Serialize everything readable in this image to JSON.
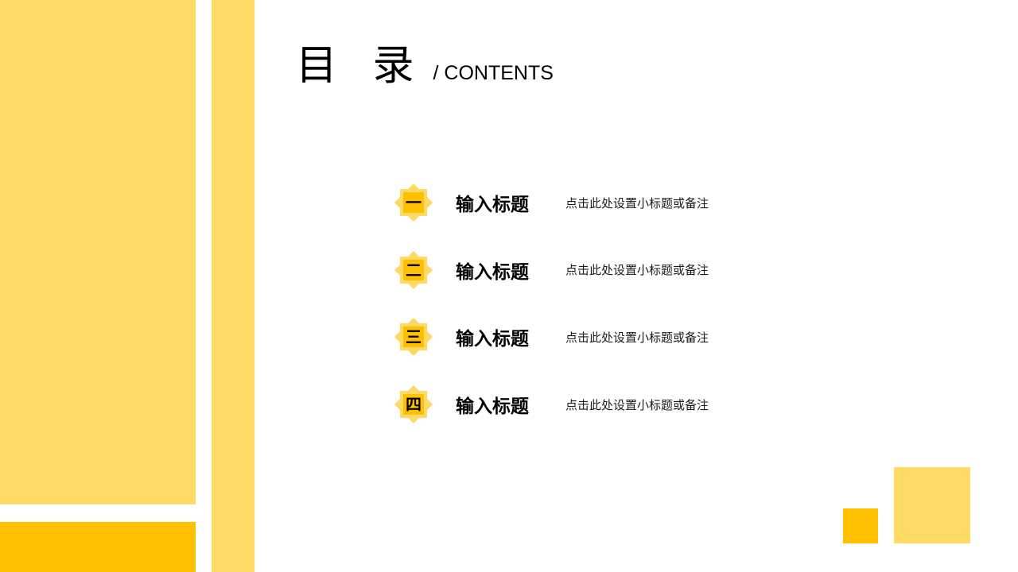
{
  "slide": {
    "heading": {
      "cn": "目 录",
      "en": "/ CONTENTS"
    },
    "contents": [
      {
        "number": "一",
        "title": "输入标题",
        "note": "点击此处设置小标题或备注"
      },
      {
        "number": "二",
        "title": "输入标题",
        "note": "点击此处设置小标题或备注"
      },
      {
        "number": "三",
        "title": "输入标题",
        "note": "点击此处设置小标题或备注"
      },
      {
        "number": "四",
        "title": "输入标题",
        "note": "点击此处设置小标题或备注"
      }
    ],
    "colors": {
      "light_yellow": "#FFD966",
      "orange": "#FFC000",
      "background": "#FFFFFF",
      "text": "#000000"
    }
  }
}
